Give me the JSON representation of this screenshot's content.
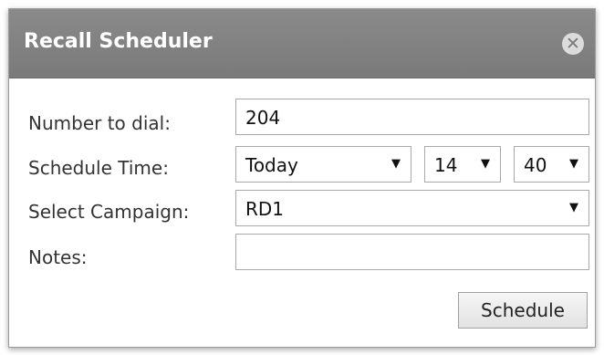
{
  "dialog": {
    "title": "Recall Scheduler",
    "close_glyph": "✕",
    "labels": {
      "number": "Number to dial:",
      "time": "Schedule Time:",
      "campaign": "Select Campaign:",
      "notes": "Notes:"
    },
    "number_value": "204",
    "schedule_day": "Today",
    "schedule_hour": "14",
    "schedule_minute": "40",
    "campaign": "RD1",
    "notes_value": "",
    "schedule_button": "Schedule",
    "dropdown_arrow": "▼"
  }
}
